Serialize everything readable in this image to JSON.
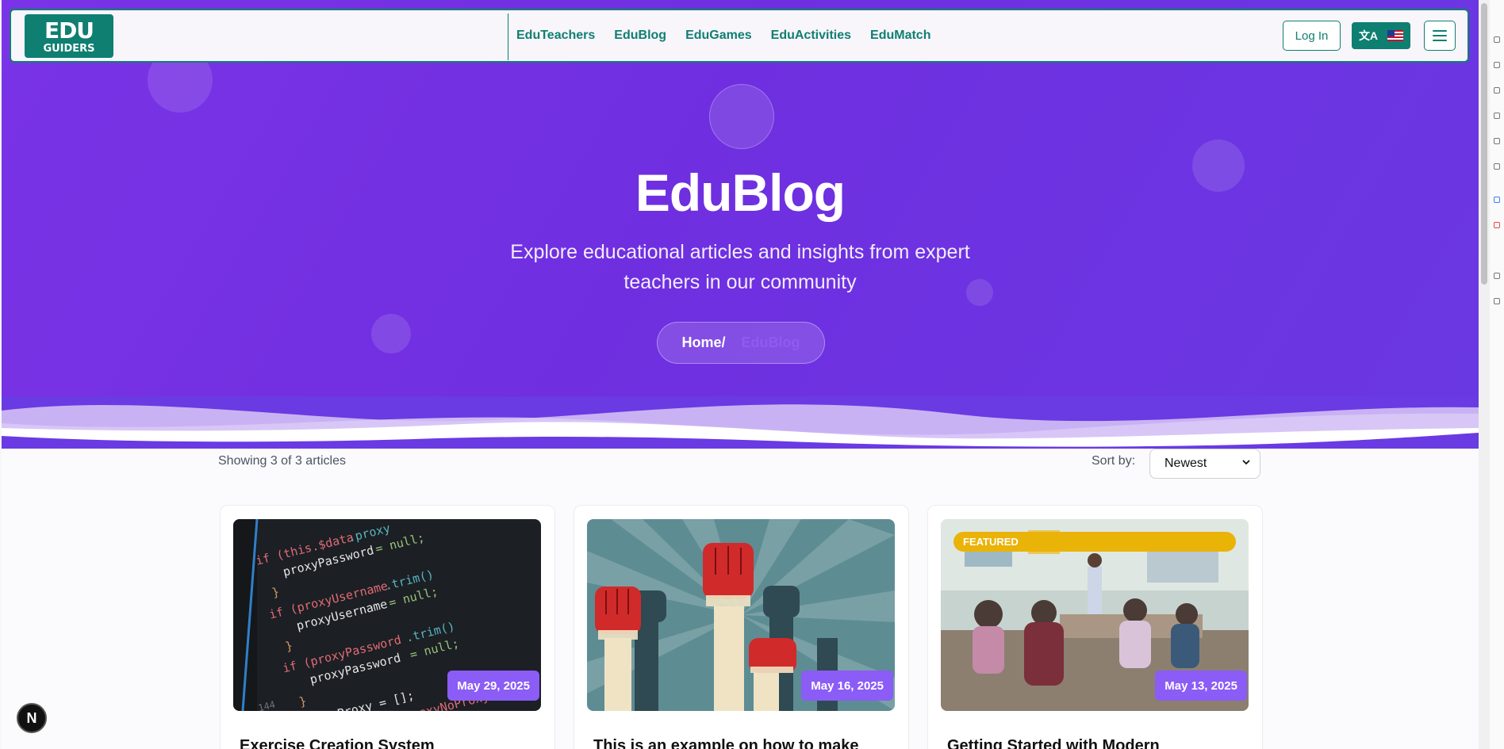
{
  "header": {
    "logo": {
      "line1": "EDU",
      "line2": "GUIDERS"
    },
    "nav": [
      "EduTeachers",
      "EduBlog",
      "EduGames",
      "EduActivities",
      "EduMatch"
    ],
    "login_label": "Log In",
    "language_icon": "translate-icon",
    "language_flag": "us-flag-icon",
    "menu_icon": "hamburger-menu-icon"
  },
  "hero": {
    "title": "EduBlog",
    "subtitle": "Explore educational articles and insights from expert teachers in our community",
    "breadcrumb": {
      "home": "Home/",
      "current": "EduBlog"
    }
  },
  "listing": {
    "showing": "Showing 3 of 3 articles",
    "sort_label": "Sort by:",
    "sort_value": "Newest"
  },
  "articles": [
    {
      "date": "May 29, 2025",
      "title": "Exercise Creation System",
      "image": "code-screenshot",
      "featured": false
    },
    {
      "date": "May 16, 2025",
      "title": "This is an example on how to make",
      "image": "raised-fists-poster",
      "featured": false
    },
    {
      "date": "May 13, 2025",
      "title": "Getting Started with Modern",
      "image": "classroom-photo",
      "featured": true,
      "badge": "FEATURED"
    }
  ],
  "colors": {
    "brand": "#0f7f71",
    "hero": "#7033e3",
    "date_badge": "#8b5cf6",
    "featured": "#eab308"
  },
  "dev_badge": "N"
}
